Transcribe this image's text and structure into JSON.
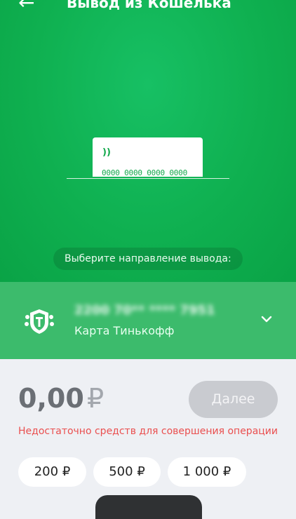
{
  "header": {
    "title": "Вывод из Кошелька",
    "back_icon": "arrow-left-icon"
  },
  "card_illustration": {
    "number": "0000 0000 0000 0000",
    "nfc_icon": "contactless-icon"
  },
  "direction_prompt": "Выберите направление вывода:",
  "selected_method": {
    "masked_number": "2200 70** **** 7951",
    "name": "Карта Тинькофф",
    "logo_icon": "tinkoff-logo-icon",
    "chevron_icon": "chevron-down-icon"
  },
  "amount": {
    "value": "0,00",
    "currency": "₽"
  },
  "next_button_label": "Далее",
  "error_text": "Недостаточно средств для совершения операции",
  "quick_amounts": [
    "200 ₽",
    "500 ₽",
    "1 000 ₽"
  ],
  "colors": {
    "accent_green": "#12a84b",
    "error_red": "#ea4f4f"
  }
}
